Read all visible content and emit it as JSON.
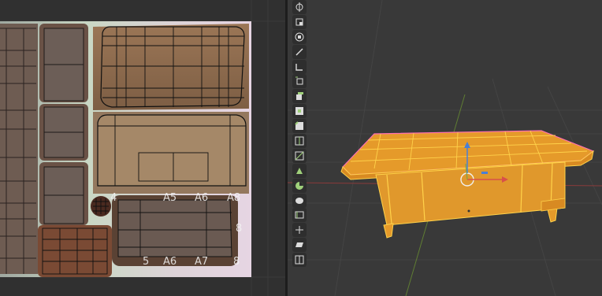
{
  "uv_editor": {
    "tile_labels": [
      {
        "id": "a8-top",
        "text": "A8"
      },
      {
        "id": "a8-right",
        "text": "8"
      },
      {
        "id": "a4",
        "text": "4"
      },
      {
        "id": "a5-top",
        "text": "A5"
      },
      {
        "id": "a6-top",
        "text": "A6"
      },
      {
        "id": "a5",
        "text": "5"
      },
      {
        "id": "a6",
        "text": "A6"
      },
      {
        "id": "a7",
        "text": "A7"
      },
      {
        "id": "a8-bottom",
        "text": "8"
      }
    ],
    "colors": {
      "background": "#303030",
      "texture": "#8a6a4c",
      "wire": "#111111",
      "uv_bg_tint": "#cfcfc8"
    }
  },
  "viewport": {
    "colors": {
      "background": "#393939",
      "mesh_fill": "#e8a030",
      "mesh_edge": "#ffd24a",
      "mesh_outline": "#ff6fb0",
      "axis_x": "#c84a4a",
      "axis_y": "#6f8f3a",
      "gizmo_z": "#4a7fd6"
    },
    "tools": [
      {
        "name": "cursor-tool",
        "icon": "cursor-icon"
      },
      {
        "name": "scale-cage-tool",
        "icon": "scale-cage-icon"
      },
      {
        "name": "transform-tool",
        "icon": "transform-icon"
      },
      {
        "name": "annotate-tool",
        "icon": "annotate-icon"
      },
      {
        "name": "measure-tool",
        "icon": "measure-icon"
      },
      {
        "name": "add-cube-tool",
        "icon": "add-cube-icon"
      },
      {
        "name": "extrude-tool",
        "icon": "extrude-icon"
      },
      {
        "name": "inset-tool",
        "icon": "inset-icon"
      },
      {
        "name": "bevel-tool",
        "icon": "bevel-icon"
      },
      {
        "name": "loop-cut-tool",
        "icon": "loop-cut-icon"
      },
      {
        "name": "knife-tool",
        "icon": "knife-icon"
      },
      {
        "name": "poly-build-tool",
        "icon": "poly-build-icon"
      },
      {
        "name": "spin-tool",
        "icon": "spin-icon"
      },
      {
        "name": "smooth-tool",
        "icon": "smooth-icon"
      },
      {
        "name": "edge-slide-tool",
        "icon": "edge-slide-icon"
      },
      {
        "name": "shrink-fatten-tool",
        "icon": "shrink-fatten-icon"
      },
      {
        "name": "shear-tool",
        "icon": "shear-icon"
      },
      {
        "name": "rip-region-tool",
        "icon": "rip-region-icon"
      }
    ]
  }
}
